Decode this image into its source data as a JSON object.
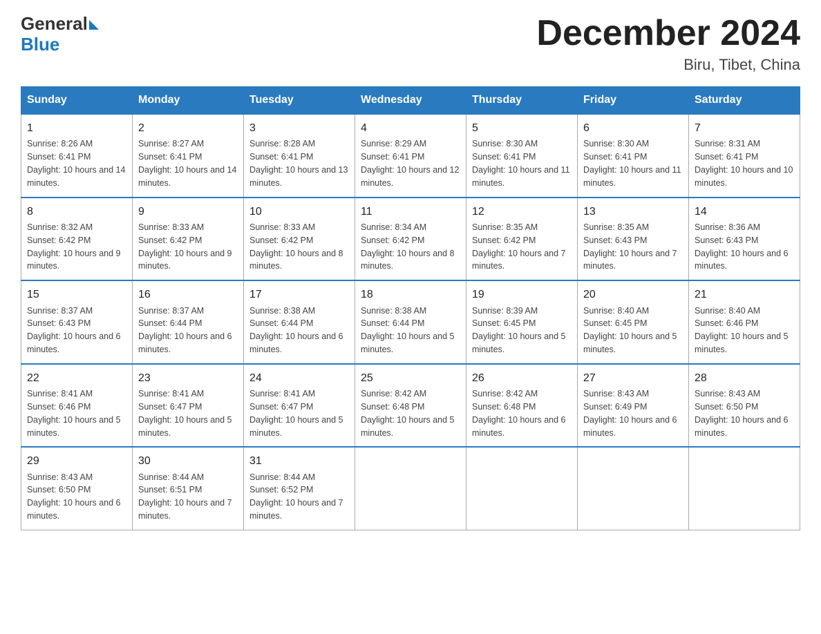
{
  "header": {
    "logo_general": "General",
    "logo_blue": "Blue",
    "month_title": "December 2024",
    "location": "Biru, Tibet, China"
  },
  "days_of_week": [
    "Sunday",
    "Monday",
    "Tuesday",
    "Wednesday",
    "Thursday",
    "Friday",
    "Saturday"
  ],
  "weeks": [
    [
      {
        "day": "1",
        "sunrise": "8:26 AM",
        "sunset": "6:41 PM",
        "daylight": "10 hours and 14 minutes."
      },
      {
        "day": "2",
        "sunrise": "8:27 AM",
        "sunset": "6:41 PM",
        "daylight": "10 hours and 14 minutes."
      },
      {
        "day": "3",
        "sunrise": "8:28 AM",
        "sunset": "6:41 PM",
        "daylight": "10 hours and 13 minutes."
      },
      {
        "day": "4",
        "sunrise": "8:29 AM",
        "sunset": "6:41 PM",
        "daylight": "10 hours and 12 minutes."
      },
      {
        "day": "5",
        "sunrise": "8:30 AM",
        "sunset": "6:41 PM",
        "daylight": "10 hours and 11 minutes."
      },
      {
        "day": "6",
        "sunrise": "8:30 AM",
        "sunset": "6:41 PM",
        "daylight": "10 hours and 11 minutes."
      },
      {
        "day": "7",
        "sunrise": "8:31 AM",
        "sunset": "6:41 PM",
        "daylight": "10 hours and 10 minutes."
      }
    ],
    [
      {
        "day": "8",
        "sunrise": "8:32 AM",
        "sunset": "6:42 PM",
        "daylight": "10 hours and 9 minutes."
      },
      {
        "day": "9",
        "sunrise": "8:33 AM",
        "sunset": "6:42 PM",
        "daylight": "10 hours and 9 minutes."
      },
      {
        "day": "10",
        "sunrise": "8:33 AM",
        "sunset": "6:42 PM",
        "daylight": "10 hours and 8 minutes."
      },
      {
        "day": "11",
        "sunrise": "8:34 AM",
        "sunset": "6:42 PM",
        "daylight": "10 hours and 8 minutes."
      },
      {
        "day": "12",
        "sunrise": "8:35 AM",
        "sunset": "6:42 PM",
        "daylight": "10 hours and 7 minutes."
      },
      {
        "day": "13",
        "sunrise": "8:35 AM",
        "sunset": "6:43 PM",
        "daylight": "10 hours and 7 minutes."
      },
      {
        "day": "14",
        "sunrise": "8:36 AM",
        "sunset": "6:43 PM",
        "daylight": "10 hours and 6 minutes."
      }
    ],
    [
      {
        "day": "15",
        "sunrise": "8:37 AM",
        "sunset": "6:43 PM",
        "daylight": "10 hours and 6 minutes."
      },
      {
        "day": "16",
        "sunrise": "8:37 AM",
        "sunset": "6:44 PM",
        "daylight": "10 hours and 6 minutes."
      },
      {
        "day": "17",
        "sunrise": "8:38 AM",
        "sunset": "6:44 PM",
        "daylight": "10 hours and 6 minutes."
      },
      {
        "day": "18",
        "sunrise": "8:38 AM",
        "sunset": "6:44 PM",
        "daylight": "10 hours and 5 minutes."
      },
      {
        "day": "19",
        "sunrise": "8:39 AM",
        "sunset": "6:45 PM",
        "daylight": "10 hours and 5 minutes."
      },
      {
        "day": "20",
        "sunrise": "8:40 AM",
        "sunset": "6:45 PM",
        "daylight": "10 hours and 5 minutes."
      },
      {
        "day": "21",
        "sunrise": "8:40 AM",
        "sunset": "6:46 PM",
        "daylight": "10 hours and 5 minutes."
      }
    ],
    [
      {
        "day": "22",
        "sunrise": "8:41 AM",
        "sunset": "6:46 PM",
        "daylight": "10 hours and 5 minutes."
      },
      {
        "day": "23",
        "sunrise": "8:41 AM",
        "sunset": "6:47 PM",
        "daylight": "10 hours and 5 minutes."
      },
      {
        "day": "24",
        "sunrise": "8:41 AM",
        "sunset": "6:47 PM",
        "daylight": "10 hours and 5 minutes."
      },
      {
        "day": "25",
        "sunrise": "8:42 AM",
        "sunset": "6:48 PM",
        "daylight": "10 hours and 5 minutes."
      },
      {
        "day": "26",
        "sunrise": "8:42 AM",
        "sunset": "6:48 PM",
        "daylight": "10 hours and 6 minutes."
      },
      {
        "day": "27",
        "sunrise": "8:43 AM",
        "sunset": "6:49 PM",
        "daylight": "10 hours and 6 minutes."
      },
      {
        "day": "28",
        "sunrise": "8:43 AM",
        "sunset": "6:50 PM",
        "daylight": "10 hours and 6 minutes."
      }
    ],
    [
      {
        "day": "29",
        "sunrise": "8:43 AM",
        "sunset": "6:50 PM",
        "daylight": "10 hours and 6 minutes."
      },
      {
        "day": "30",
        "sunrise": "8:44 AM",
        "sunset": "6:51 PM",
        "daylight": "10 hours and 7 minutes."
      },
      {
        "day": "31",
        "sunrise": "8:44 AM",
        "sunset": "6:52 PM",
        "daylight": "10 hours and 7 minutes."
      },
      null,
      null,
      null,
      null
    ]
  ]
}
